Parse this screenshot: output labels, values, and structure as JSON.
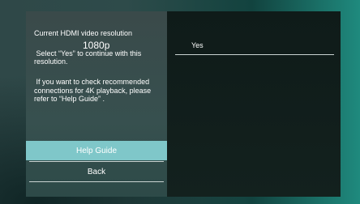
{
  "dialog": {
    "label_current": "Current HDMI video resolution",
    "resolution": "1080p",
    "instruction": "Select “Yes” to continue with this resolution.",
    "help_text": "If you want to check recommended connections for 4K playback, please refer to “Help Guide” .",
    "buttons": {
      "help_guide": "Help Guide",
      "back": "Back"
    },
    "options": {
      "yes": "Yes"
    }
  },
  "colors": {
    "selected_button": "#7fc7c9",
    "panel_left": "#3a4a4a",
    "panel_right": "#13211e"
  }
}
